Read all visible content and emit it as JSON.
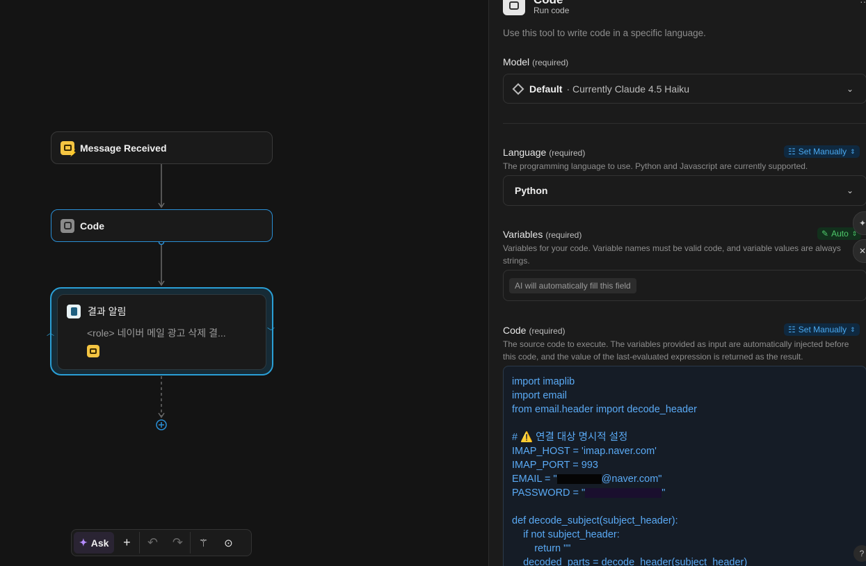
{
  "canvas": {
    "nodes": {
      "message_received": {
        "title": "Message Received"
      },
      "code": {
        "title": "Code"
      },
      "result": {
        "title": "결과 알림",
        "subtitle": "<role> 네이버 메일 광고 삭제 결..."
      }
    }
  },
  "toolbar": {
    "ask_label": "Ask",
    "add_icon": "plus-icon",
    "undo_icon": "undo-icon",
    "redo_icon": "redo-icon",
    "tidy_icon": "magic-wand-icon",
    "focus_icon": "focus-icon"
  },
  "panel": {
    "header": {
      "title": "Code",
      "subtitle": "Run code",
      "menu_glyph": "···"
    },
    "description": "Use this tool to write code in a specific language.",
    "model": {
      "label": "Model",
      "required": "(required)",
      "name": "Default",
      "detail": "· Currently Claude 4.5 Haiku"
    },
    "language": {
      "label": "Language",
      "required": "(required)",
      "mode": "Set Manually",
      "help": "The programming language to use. Python and Javascript are currently supported.",
      "value": "Python"
    },
    "variables": {
      "label": "Variables",
      "required": "(required)",
      "mode": "Auto",
      "help": "Variables for your code. Variable names must be valid code, and variable values are always strings.",
      "placeholder": "AI will automatically fill this field"
    },
    "code": {
      "label": "Code",
      "required": "(required)",
      "mode": "Set Manually",
      "help": "The source code to execute. The variables provided as input are automatically injected before this code, and the value of the last-evaluated expression is returned as the result.",
      "lines": [
        "import imaplib",
        "import email",
        "from email.header import decode_header",
        "",
        "# ⚠️ 연결 대상 명시적 설정",
        "IMAP_HOST = 'imap.naver.com'",
        "IMAP_PORT = 993",
        "EMAIL = \"",
        "PASSWORD = \"",
        "",
        "def decode_subject(subject_header):",
        "    if not subject_header:",
        "        return \"\"",
        "    decoded_parts = decode_header(subject_header)"
      ],
      "email_suffix": "@naver.com\"",
      "password_suffix": "\""
    }
  },
  "colors": {
    "accent": "#2a9fd6",
    "code_text": "#5aaaf5",
    "auto_green": "#4fc96b",
    "ask_purple": "#b58cff"
  }
}
